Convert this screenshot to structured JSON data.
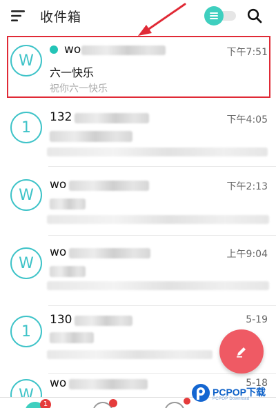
{
  "header": {
    "title": "收件箱",
    "menu_icon": "hamburger-menu-icon",
    "toggle_icon": "list-toggle-icon",
    "search_icon": "search-icon"
  },
  "emails": [
    {
      "avatar": "W",
      "sender": "wo",
      "time": "下午7:51",
      "subject": "六一快乐",
      "preview": "祝你六一快乐",
      "unread": true,
      "highlighted": true
    },
    {
      "avatar": "1",
      "sender": "132",
      "time": "下午4:05",
      "subject": "",
      "preview": "",
      "unread": false
    },
    {
      "avatar": "W",
      "sender": "wo",
      "time": "下午2:13",
      "subject": "",
      "preview": "",
      "unread": false
    },
    {
      "avatar": "W",
      "sender": "wo",
      "time": "上午9:04",
      "subject": "",
      "preview": "",
      "unread": false
    },
    {
      "avatar": "1",
      "sender": "130",
      "time": "5-19",
      "subject": "",
      "preview": "",
      "unread": false
    },
    {
      "avatar": "W",
      "sender": "wo",
      "time": "5-18",
      "subject": "",
      "preview": "",
      "unread": false
    }
  ],
  "fab": {
    "icon": "compose-pencil-icon"
  },
  "bottom_bar": {
    "badges": [
      "1"
    ]
  },
  "watermark": {
    "brand": "PCPOP下载",
    "sub": "PCPOP Download"
  },
  "colors": {
    "accent": "#3ec3c8",
    "unread_dot": "#23c4b7",
    "fab": "#ef5a64",
    "highlight": "#e02a36"
  }
}
